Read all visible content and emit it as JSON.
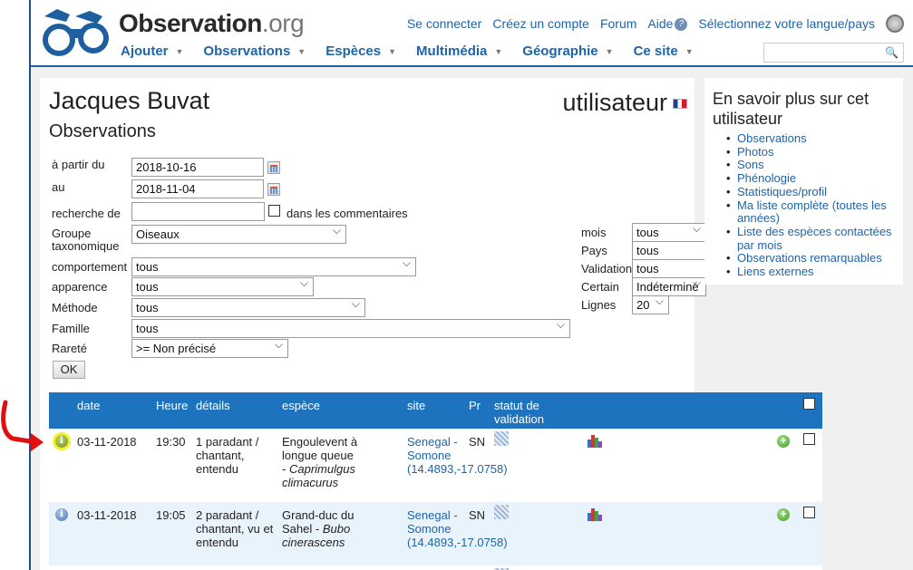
{
  "site": {
    "name_main": "Observation",
    "name_tld": ".org"
  },
  "top_links": {
    "login": "Se connecter",
    "create_account": "Créez un compte",
    "forum": "Forum",
    "help": "Aide",
    "language": "Sélectionnez votre langue/pays"
  },
  "nav": [
    {
      "label": "Ajouter"
    },
    {
      "label": "Observations"
    },
    {
      "label": "Espèces"
    },
    {
      "label": "Multimédia"
    },
    {
      "label": "Géographie"
    },
    {
      "label": "Ce site"
    }
  ],
  "search": {
    "value": ""
  },
  "page": {
    "user_name": "Jacques Buvat",
    "role": "utilisateur",
    "section_title": "Observations"
  },
  "form": {
    "from_label": "à partir du",
    "from_value": "2018-10-16",
    "to_label": "au",
    "to_value": "2018-11-04",
    "search_label": "recherche de",
    "search_value": "",
    "comments_label": "dans les commentaires",
    "taxo_label": "Groupe taxonomique",
    "taxo_value": "Oiseaux",
    "behaviour_label": "comportement",
    "behaviour_value": "tous",
    "appearance_label": "apparence",
    "appearance_value": "tous",
    "method_label": "Méthode",
    "method_value": "tous",
    "family_label": "Famille",
    "family_value": "tous",
    "rarity_label": "Rareté",
    "rarity_value": ">= Non précisé",
    "month_label": "mois",
    "month_value": "tous",
    "country_label": "Pays",
    "country_value": "tous",
    "validation_label": "Validation",
    "validation_value": "tous",
    "certain_label": "Certain",
    "certain_value": "Indéterminé",
    "rows_label": "Lignes",
    "rows_value": "20",
    "ok_label": "OK"
  },
  "table": {
    "headers": {
      "date": "date",
      "hour": "Heure",
      "details": "détails",
      "species": "espèce",
      "site": "site",
      "pr": "Pr",
      "status": "statut de validation"
    },
    "rows": [
      {
        "date": "03-11-2018",
        "hour": "19:30",
        "details": "1 paradant / chantant, entendu",
        "species_common": "Engoulevent à longue queue -",
        "species_latin": "Caprimulgus climacurus",
        "site": "Senegal - Somone (14.4893,-17.0758)",
        "pr": "SN"
      },
      {
        "date": "03-11-2018",
        "hour": "19:05",
        "details": "2 paradant / chantant, vu et entendu",
        "species_common": "Grand-duc du Sahel -",
        "species_latin": "Bubo cinerascens",
        "site": "Senegal - Somone (14.4893,-17.0758)",
        "pr": "SN"
      }
    ]
  },
  "sidebar": {
    "title": "En savoir plus sur cet utilisateur",
    "items": [
      {
        "label": "Observations"
      },
      {
        "label": "Photos"
      },
      {
        "label": "Sons"
      },
      {
        "label": "Phénologie"
      },
      {
        "label": "Statistiques/profil"
      },
      {
        "label": "Ma liste complète (toutes les années)"
      },
      {
        "label": "Liste des espèces contactées par mois"
      },
      {
        "label": "Observations remarquables"
      },
      {
        "label": "Liens externes"
      }
    ]
  },
  "colors": {
    "brand_blue": "#1e73be",
    "link_blue": "#1f64a8",
    "highlight_yellow": "#f4f32a",
    "annotation_red": "#e01010"
  },
  "icons": [
    "binoculars-logo-icon",
    "help-icon",
    "globe-icon",
    "search-icon",
    "calendar-icon",
    "info-icon",
    "hatch-status-icon",
    "stats-chart-icon",
    "add-icon",
    "checkbox"
  ]
}
